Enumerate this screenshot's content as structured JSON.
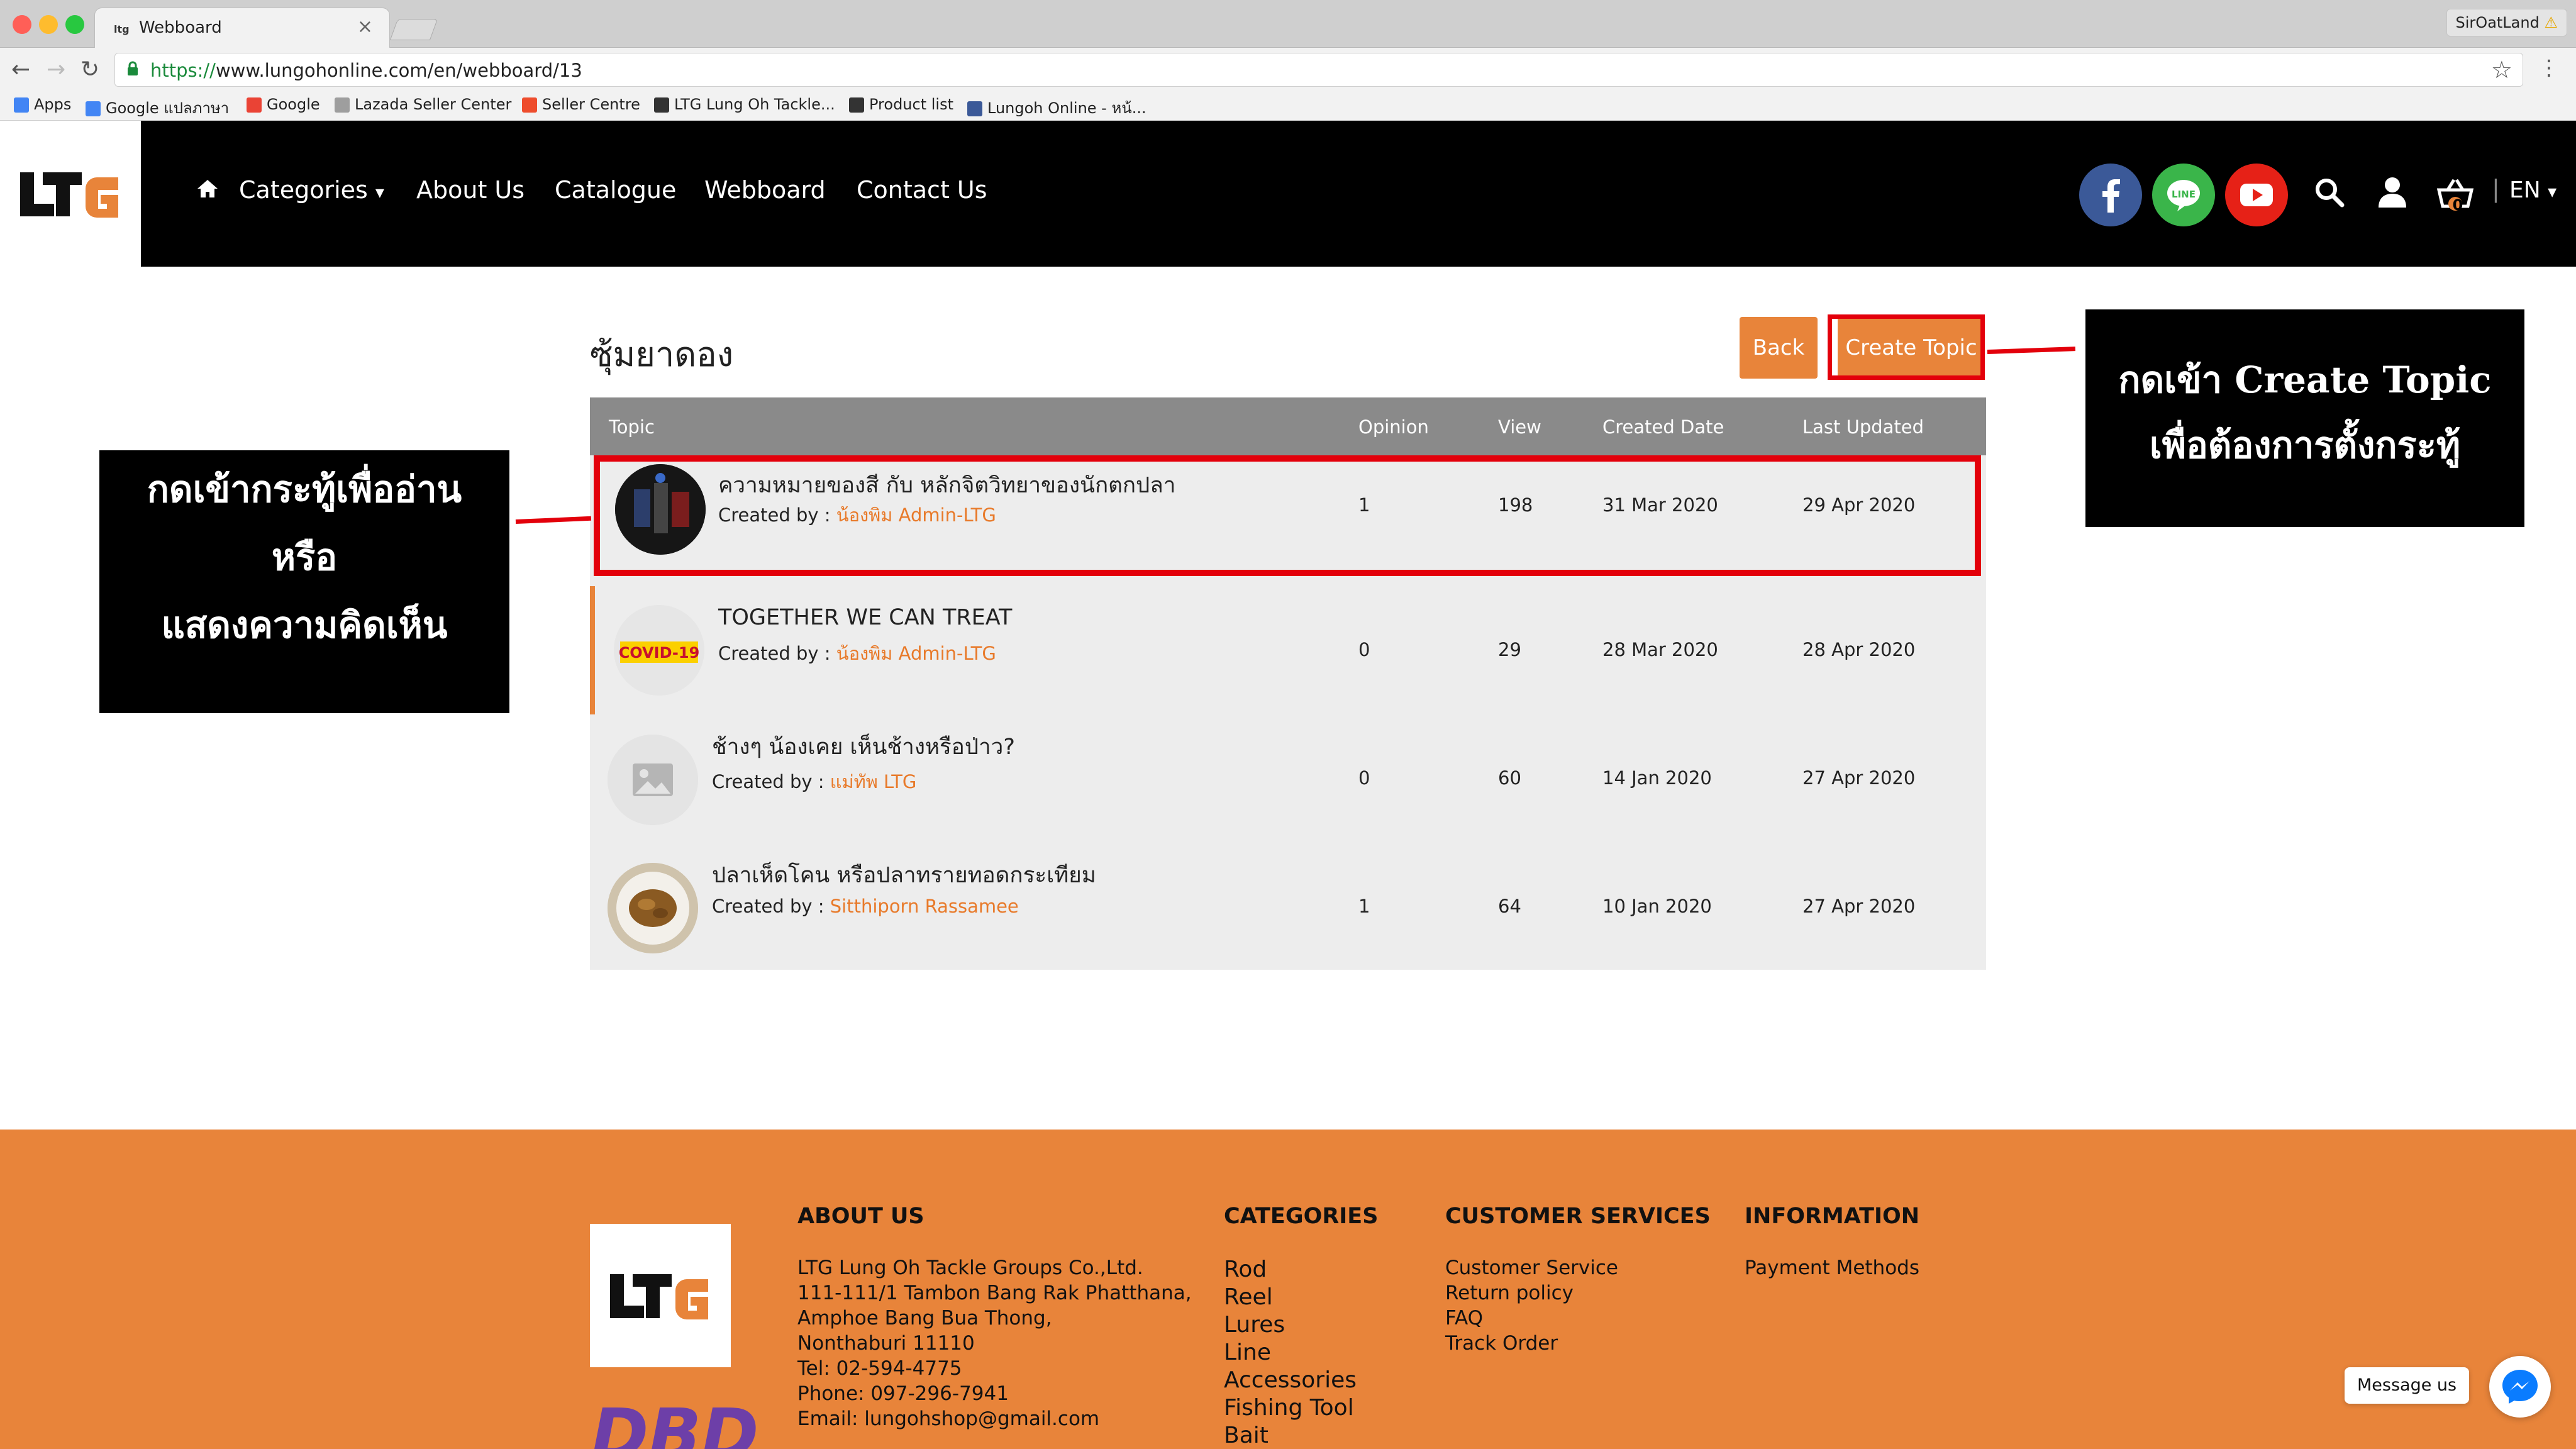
{
  "browser": {
    "tab_title": "Webboard",
    "tab_favicon": "ltg",
    "tab_close": "×",
    "profile": "SirOatLand",
    "profile_warning": "⚠",
    "url_scheme": "https://",
    "url_rest": "www.lungohonline.com/en/webboard/13",
    "bookmarks": [
      {
        "label": "Apps",
        "icon": "apps-grid-icon",
        "color": "#4285f4"
      },
      {
        "label": "Google แปลภาษา",
        "icon": "google-translate-icon",
        "color": "#4285f4"
      },
      {
        "label": "Google",
        "icon": "google-icon",
        "color": "#ea4335"
      },
      {
        "label": "Lazada Seller Center",
        "icon": "page-icon",
        "color": "#9e9e9e"
      },
      {
        "label": "Seller Centre",
        "icon": "shopee-icon",
        "color": "#ee4d2d"
      },
      {
        "label": "LTG Lung Oh Tackle...",
        "icon": "ltg-icon",
        "color": "#333333"
      },
      {
        "label": "Product list",
        "icon": "ltg-icon",
        "color": "#333333"
      },
      {
        "label": "Lungoh Online - หน้...",
        "icon": "facebook-icon",
        "color": "#3b5998"
      }
    ]
  },
  "header": {
    "nav": [
      "Categories",
      "About Us",
      "Catalogue",
      "Webboard",
      "Contact Us"
    ],
    "lang": "EN",
    "cart_count": "0",
    "social_colors": {
      "facebook": "#3b5998",
      "line": "#3ab54a",
      "youtube": "#e62117"
    }
  },
  "page": {
    "title": "ซุ้มยาดอง",
    "back_label": "Back",
    "create_label": "Create Topic"
  },
  "table": {
    "headers": [
      "Topic",
      "Opinion",
      "View",
      "Created Date",
      "Last Updated"
    ],
    "created_by_label": "Created by : ",
    "rows": [
      {
        "title": "ความหมายของสี กับ หลักจิตวิทยาของนักตกปลา",
        "author": "น้องพิม Admin-LTG",
        "opinion": "1",
        "view": "198",
        "created": "31 Mar 2020",
        "updated": "29 Apr 2020",
        "avatar": "product-photo"
      },
      {
        "title": "TOGETHER WE CAN TREAT",
        "author": "น้องพิม Admin-LTG",
        "opinion": "0",
        "view": "29",
        "created": "28 Mar 2020",
        "updated": "28 Apr 2020",
        "avatar": "covid-19"
      },
      {
        "title": "ช้างๆ น้องเคย เห็นช้างหรือป่าว?",
        "author": "แม่ทัพ LTG",
        "opinion": "0",
        "view": "60",
        "created": "14 Jan 2020",
        "updated": "27 Apr 2020",
        "avatar": "image-placeholder-icon"
      },
      {
        "title": "ปลาเห็ดโคน หรือปลาทรายทอดกระเทียม",
        "author": "Sitthiporn Rassamee",
        "opinion": "1",
        "view": "64",
        "created": "10 Jan 2020",
        "updated": "27 Apr 2020",
        "avatar": "food-photo"
      }
    ],
    "avatar_covid_text": "COVID-19"
  },
  "annotations": {
    "left": [
      "กดเข้ากระทู้เพื่ออ่าน",
      "หรือ",
      "แสดงความคิดเห็น"
    ],
    "right": [
      "กดเข้า Create Topic",
      "เพื่อต้องการตั้งกระทู้"
    ],
    "highlight_color": "#e3000b"
  },
  "footer": {
    "logo_text": "LTG",
    "dbd_text": "DBD",
    "about_head": "ABOUT US",
    "about_lines": [
      "LTG Lung Oh Tackle Groups Co.,Ltd.",
      "111-111/1 Tambon Bang Rak Phatthana,",
      "Amphoe Bang Bua Thong,",
      "Nonthaburi 11110",
      "Tel: 02-594-4775",
      "Phone: 097-296-7941",
      "Email: lungohshop@gmail.com"
    ],
    "categories_head": "CATEGORIES",
    "categories": [
      "Rod",
      "Reel",
      "Lures",
      "Line",
      "Accessories",
      "Fishing Tool",
      "Bait"
    ],
    "services_head": "CUSTOMER SERVICES",
    "services": [
      "Customer Service",
      "Return policy",
      "FAQ",
      "Track Order"
    ],
    "info_head": "INFORMATION",
    "info": [
      "Payment Methods"
    ],
    "message_label": "Message us",
    "accent": "#e8843a"
  }
}
